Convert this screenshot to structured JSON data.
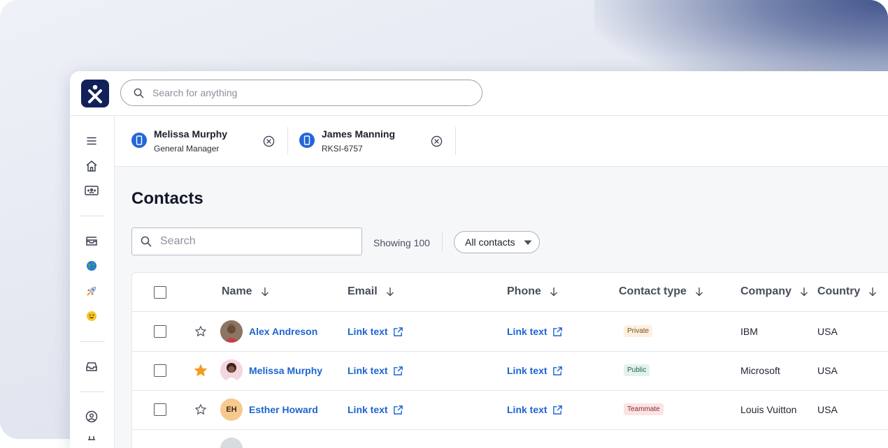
{
  "search": {
    "placeholder": "Search for anything"
  },
  "colors": {
    "brand": "#13215a",
    "link": "#1d64cf",
    "tab_icon": "#2367d9",
    "favorite": "#f29b22"
  },
  "sidebar": {
    "items": [
      {
        "icon": "menu-icon"
      },
      {
        "icon": "home-icon"
      },
      {
        "icon": "contacts-card-icon"
      },
      {
        "icon": "inbox-stack-icon"
      },
      {
        "icon": "globe-emoji-icon"
      },
      {
        "icon": "rocket-emoji-icon"
      },
      {
        "icon": "smiley-emoji-icon"
      },
      {
        "icon": "tray-icon"
      },
      {
        "icon": "user-circle-icon"
      }
    ]
  },
  "tabs": [
    {
      "name": "Melissa Murphy",
      "subtitle": "General Manager",
      "icon": "mobile-phone-icon"
    },
    {
      "name": "James Manning",
      "subtitle": "RKSI-6757",
      "icon": "mobile-phone-icon"
    }
  ],
  "page": {
    "title": "Contacts"
  },
  "contacts_search": {
    "placeholder": "Search"
  },
  "showing": "Showing 100",
  "filter": {
    "selected": "All contacts"
  },
  "table": {
    "columns": [
      "Name",
      "Email",
      "Phone",
      "Contact type",
      "Company",
      "Country"
    ],
    "rows": [
      {
        "name": "Alex Andreson",
        "favorite": false,
        "initials": "",
        "email": "Link text",
        "phone": "Link text",
        "type": "Private",
        "type_bg": "#fdf0e1",
        "type_fg": "#7a4b12",
        "company": "IBM",
        "country": "USA"
      },
      {
        "name": "Melissa Murphy",
        "favorite": true,
        "initials": "",
        "email": "Link text",
        "phone": "Link text",
        "type": "Public",
        "type_bg": "#e2f3ec",
        "type_fg": "#1f6048",
        "company": "Microsoft",
        "country": "USA"
      },
      {
        "name": "Esther Howard",
        "favorite": false,
        "initials": "EH",
        "email": "Link text",
        "phone": "Link text",
        "type": "Teammate",
        "type_bg": "#fbe4e4",
        "type_fg": "#8c2c2c",
        "company": "Louis Vuitton",
        "country": "USA"
      }
    ]
  }
}
